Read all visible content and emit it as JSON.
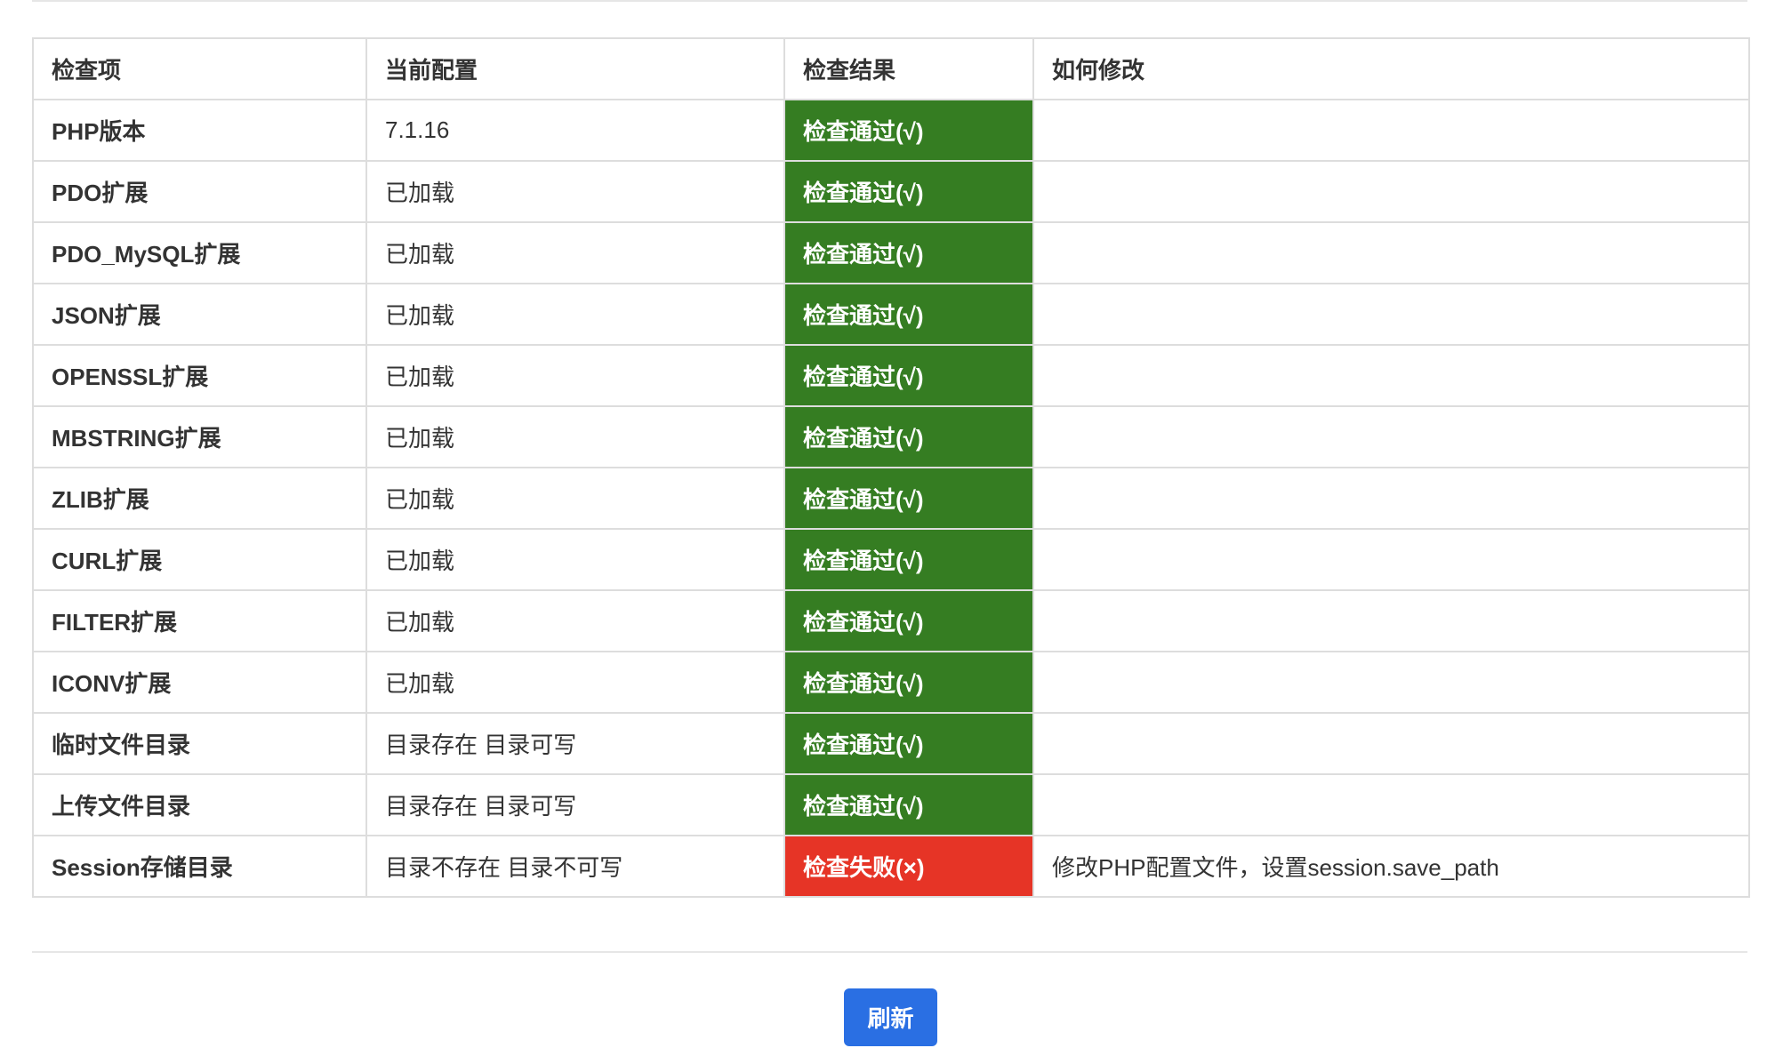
{
  "table": {
    "headers": [
      "检查项",
      "当前配置",
      "检查结果",
      "如何修改"
    ],
    "rows": [
      {
        "item": "PHP版本",
        "config": "7.1.16",
        "result": "检查通过(√)",
        "status": "pass",
        "fix": ""
      },
      {
        "item": "PDO扩展",
        "config": "已加载",
        "result": "检查通过(√)",
        "status": "pass",
        "fix": ""
      },
      {
        "item": "PDO_MySQL扩展",
        "config": "已加载",
        "result": "检查通过(√)",
        "status": "pass",
        "fix": ""
      },
      {
        "item": "JSON扩展",
        "config": "已加载",
        "result": "检查通过(√)",
        "status": "pass",
        "fix": ""
      },
      {
        "item": "OPENSSL扩展",
        "config": "已加载",
        "result": "检查通过(√)",
        "status": "pass",
        "fix": ""
      },
      {
        "item": "MBSTRING扩展",
        "config": "已加载",
        "result": "检查通过(√)",
        "status": "pass",
        "fix": ""
      },
      {
        "item": "ZLIB扩展",
        "config": "已加载",
        "result": "检查通过(√)",
        "status": "pass",
        "fix": ""
      },
      {
        "item": "CURL扩展",
        "config": "已加载",
        "result": "检查通过(√)",
        "status": "pass",
        "fix": ""
      },
      {
        "item": "FILTER扩展",
        "config": "已加载",
        "result": "检查通过(√)",
        "status": "pass",
        "fix": ""
      },
      {
        "item": "ICONV扩展",
        "config": "已加载",
        "result": "检查通过(√)",
        "status": "pass",
        "fix": ""
      },
      {
        "item": "临时文件目录",
        "config": "目录存在 目录可写",
        "result": "检查通过(√)",
        "status": "pass",
        "fix": ""
      },
      {
        "item": "上传文件目录",
        "config": "目录存在 目录可写",
        "result": "检查通过(√)",
        "status": "pass",
        "fix": ""
      },
      {
        "item": "Session存储目录",
        "config": "目录不存在 目录不可写",
        "result": "检查失败(×)",
        "status": "fail",
        "fix": "修改PHP配置文件，设置session.save_path"
      }
    ]
  },
  "colors": {
    "pass": "#357d22",
    "fail": "#e63426",
    "button": "#2a6fe3",
    "border": "#dddddd"
  },
  "actions": {
    "refresh_label": "刷新"
  }
}
